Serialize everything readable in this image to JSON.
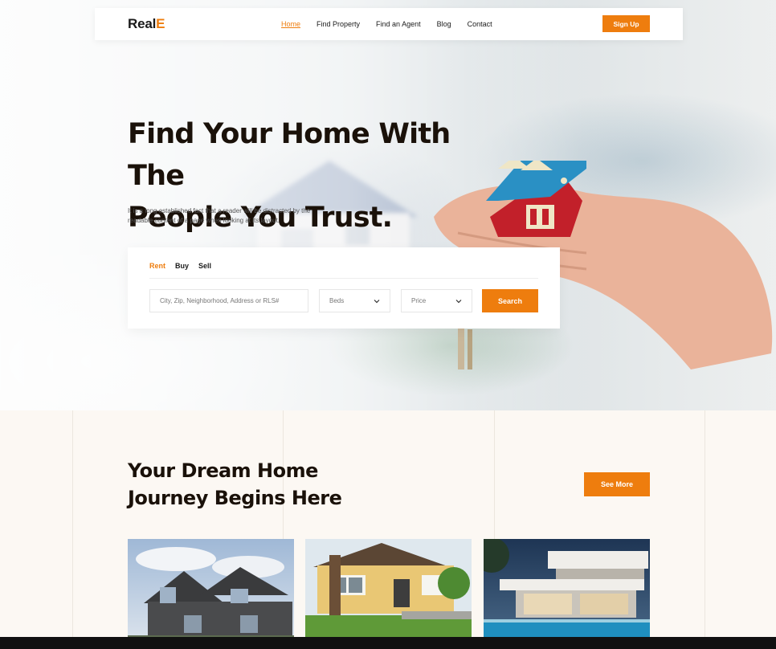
{
  "brand": {
    "logo_main": "Real",
    "logo_accent": "E",
    "accent_color": "#ee7d0e"
  },
  "nav": {
    "items": [
      {
        "label": "Home",
        "active": true
      },
      {
        "label": "Find Property",
        "active": false
      },
      {
        "label": "Find an Agent",
        "active": false
      },
      {
        "label": "Blog",
        "active": false
      },
      {
        "label": "Contact",
        "active": false
      }
    ],
    "signup_label": "Sign Up"
  },
  "hero": {
    "title_line1": "Find Your Home With The",
    "title_line2": "People You Trust.",
    "subtitle": "It is a long established fact that a reader will be distracted by the readable content of a page when looking at its layout."
  },
  "search": {
    "tabs": [
      {
        "label": "Rent",
        "active": true
      },
      {
        "label": "Buy",
        "active": false
      },
      {
        "label": "Sell",
        "active": false
      }
    ],
    "location_placeholder": "City, Zip, Neighborhood, Address or RLS#",
    "beds_label": "Beds",
    "price_label": "Price",
    "button_label": "Search"
  },
  "section": {
    "title_line1": "Your Dream Home",
    "title_line2": "Journey Begins Here",
    "see_more_label": "See More"
  }
}
